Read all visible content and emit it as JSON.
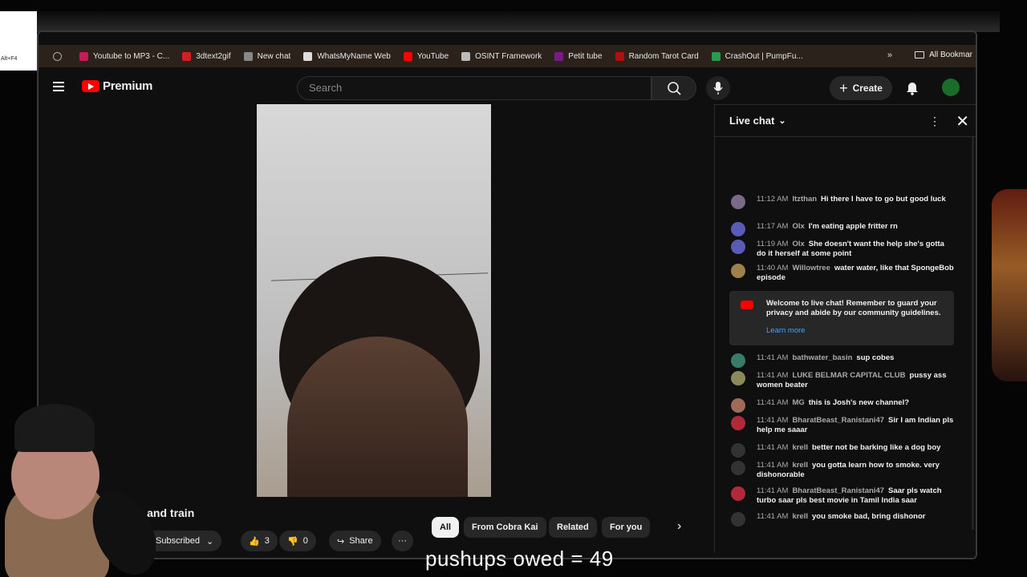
{
  "alt_badge": "Alt+F4",
  "bookmarks": {
    "items": [
      {
        "label": "Youtube to MP3 - C...",
        "icon": "youtube-mp3-icon",
        "color": "#c41c5a"
      },
      {
        "label": "3dtext2gif",
        "icon": "3dtext-icon",
        "color": "#d02020"
      },
      {
        "label": "New chat",
        "icon": "chat-icon",
        "color": "#888888"
      },
      {
        "label": "WhatsMyName Web",
        "icon": "doc-icon",
        "color": "#dddddd"
      },
      {
        "label": "YouTube",
        "icon": "youtube-icon",
        "color": "#ff0000"
      },
      {
        "label": "OSINT Framework",
        "icon": "globe-icon",
        "color": "#bbbbbb"
      },
      {
        "label": "Petit tube",
        "icon": "petit-tube-icon",
        "color": "#7a1a8a"
      },
      {
        "label": "Random Tarot Card",
        "icon": "tarot-icon",
        "color": "#b01010"
      },
      {
        "label": "CrashOut | PumpFu...",
        "icon": "crashout-icon",
        "color": "#2a9a4a"
      }
    ],
    "more": "»",
    "all_bookmarks": "All Bookmar"
  },
  "header": {
    "brand": "Premium",
    "search_placeholder": "Search",
    "create_label": "Create"
  },
  "video": {
    "title": "rk and train",
    "subscribed": "Subscribed",
    "likes": "3",
    "dislikes": "0",
    "share": "Share",
    "more": "···"
  },
  "chips": [
    "All",
    "From Cobra Kai",
    "Related",
    "For you"
  ],
  "chat": {
    "title": "Live chat",
    "messages": [
      {
        "time": "11:12 AM",
        "author": "Itzthan",
        "text": "Hi there I have to go but good luck",
        "color": "#7a6a8a"
      },
      {
        "time": "11:17 AM",
        "author": "Olx",
        "text": "I'm eating apple fritter rn",
        "color": "#5a5ab8"
      },
      {
        "time": "11:19 AM",
        "author": "Olx",
        "text": "She doesn't want the help she's gotta do it herself at some point",
        "color": "#5a5ab8"
      },
      {
        "time": "11:40 AM",
        "author": "Willowtree",
        "text": "water water, like that SpongeBob episode",
        "color": "#a0804a"
      },
      {
        "time": "11:41 AM",
        "author": "bathwater_basin",
        "text": "sup cobes",
        "color": "#3a7a6a"
      },
      {
        "time": "11:41 AM",
        "author": "LUKE BELMAR CAPITAL CLUB",
        "text": "pussy ass women beater",
        "color": "#8a8a5a"
      },
      {
        "time": "11:41 AM",
        "author": "MG",
        "text": "this is Josh's new channel?",
        "color": "#a06a5a"
      },
      {
        "time": "11:41 AM",
        "author": "BharatBeast_Ranistani47",
        "text": "Sir I am Indian pls help me saaar",
        "color": "#b02a3a"
      },
      {
        "time": "11:41 AM",
        "author": "krell",
        "text": "better not be barking like a dog boy",
        "color": "#333333"
      },
      {
        "time": "11:41 AM",
        "author": "krell",
        "text": "you gotta learn how to smoke. very dishonorable",
        "color": "#333333"
      },
      {
        "time": "11:41 AM",
        "author": "BharatBeast_Ranistani47",
        "text": "Saar pls watch turbo saar pls best movie in Tamil India saar",
        "color": "#b02a3a"
      },
      {
        "time": "11:41 AM",
        "author": "krell",
        "text": "you smoke bad, bring dishonor",
        "color": "#333333"
      }
    ],
    "welcome_text": "Welcome to live chat! Remember to guard your privacy and abide by our community guidelines.",
    "learn_more": "Learn more"
  },
  "caption": "pushups owed = 49"
}
